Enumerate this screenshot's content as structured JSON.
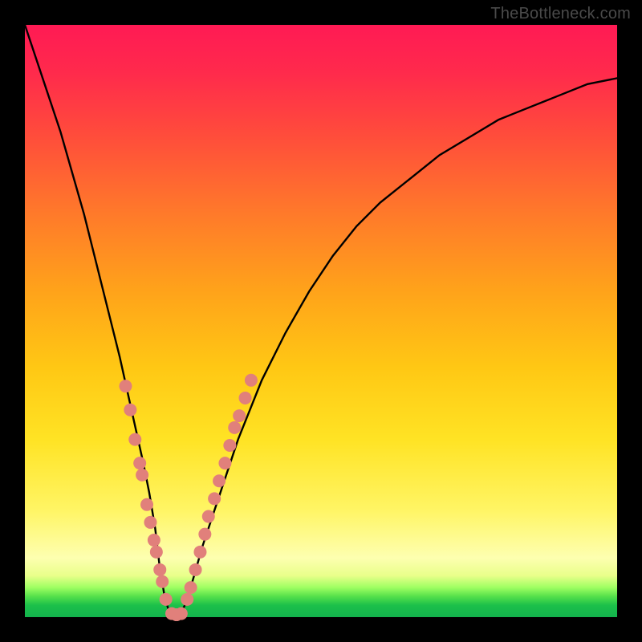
{
  "watermark": "TheBottleneck.com",
  "colors": {
    "curve": "#000000",
    "marker_fill": "#e1807b",
    "marker_stroke": "#c9615c",
    "frame": "#000000"
  },
  "chart_data": {
    "type": "line",
    "title": "",
    "xlabel": "",
    "ylabel": "",
    "xlim": [
      0,
      100
    ],
    "ylim": [
      0,
      100
    ],
    "series": [
      {
        "name": "bottleneck-curve",
        "x": [
          0,
          2,
          4,
          6,
          8,
          10,
          12,
          14,
          16,
          18,
          20,
          21,
          22,
          22.7,
          23.5,
          24.3,
          25.1,
          26,
          27,
          28,
          30,
          32,
          34,
          36,
          38,
          40,
          44,
          48,
          52,
          56,
          60,
          65,
          70,
          75,
          80,
          85,
          90,
          95,
          100
        ],
        "values": [
          100,
          94,
          88,
          82,
          75,
          68,
          60,
          52,
          44,
          35,
          26,
          21,
          15,
          9,
          4,
          1,
          0,
          0,
          2,
          5,
          12,
          18,
          24,
          30,
          35,
          40,
          48,
          55,
          61,
          66,
          70,
          74,
          78,
          81,
          84,
          86,
          88,
          90,
          91
        ]
      }
    ],
    "markers": [
      {
        "x": 17.0,
        "y": 39
      },
      {
        "x": 17.8,
        "y": 35
      },
      {
        "x": 18.6,
        "y": 30
      },
      {
        "x": 19.4,
        "y": 26
      },
      {
        "x": 19.8,
        "y": 24
      },
      {
        "x": 20.6,
        "y": 19
      },
      {
        "x": 21.2,
        "y": 16
      },
      {
        "x": 21.8,
        "y": 13
      },
      {
        "x": 22.2,
        "y": 11
      },
      {
        "x": 22.8,
        "y": 8
      },
      {
        "x": 23.2,
        "y": 6
      },
      {
        "x": 23.8,
        "y": 3
      },
      {
        "x": 24.8,
        "y": 0.6
      },
      {
        "x": 25.6,
        "y": 0.4
      },
      {
        "x": 26.4,
        "y": 0.6
      },
      {
        "x": 27.4,
        "y": 3
      },
      {
        "x": 28.0,
        "y": 5
      },
      {
        "x": 28.8,
        "y": 8
      },
      {
        "x": 29.6,
        "y": 11
      },
      {
        "x": 30.4,
        "y": 14
      },
      {
        "x": 31.0,
        "y": 17
      },
      {
        "x": 32.0,
        "y": 20
      },
      {
        "x": 32.8,
        "y": 23
      },
      {
        "x": 33.8,
        "y": 26
      },
      {
        "x": 34.6,
        "y": 29
      },
      {
        "x": 35.4,
        "y": 32
      },
      {
        "x": 36.2,
        "y": 34
      },
      {
        "x": 37.2,
        "y": 37
      },
      {
        "x": 38.2,
        "y": 40
      }
    ]
  }
}
